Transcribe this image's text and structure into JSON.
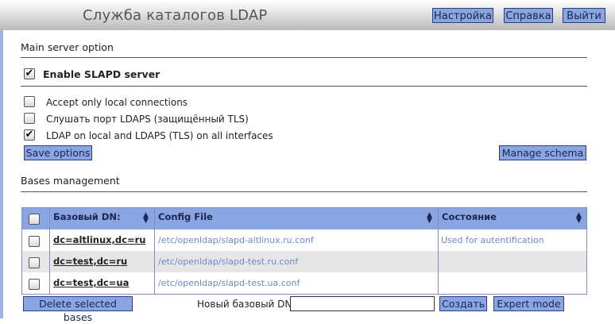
{
  "header": {
    "title": "Служба каталогов LDAP",
    "buttons": {
      "settings": "Настройка",
      "help": "Справка",
      "logout": "Выйти"
    }
  },
  "main_server": {
    "section_title": "Main server option",
    "enable_slapd": {
      "label": "Enable SLAPD server",
      "checked": true
    },
    "options": [
      {
        "label": "Accept only local connections",
        "checked": false
      },
      {
        "label": "Слушать порт LDAPS (защищённый TLS)",
        "checked": false
      },
      {
        "label": "LDAP on local and LDAPS (TLS) on all interfaces",
        "checked": true
      }
    ],
    "save_button": "Save options",
    "manage_schema_button": "Manage schema"
  },
  "bases": {
    "section_title": "Bases management",
    "columns": {
      "dn": "Базовый DN:",
      "config": "Config File",
      "state": "Состояние"
    },
    "rows": [
      {
        "dn": "dc=altlinux,dc=ru",
        "config": "/etc/openldap/slapd-altlinux.ru.conf",
        "state": "Used for autentification",
        "checked": false
      },
      {
        "dn": "dc=test,dc=ru",
        "config": "/etc/openldap/slapd-test.ru.conf",
        "state": "",
        "checked": false
      },
      {
        "dn": "dc=test,dc=ua",
        "config": "/etc/openldap/slapd-test.ua.conf",
        "state": "",
        "checked": false
      }
    ],
    "delete_button": "Delete selected bases",
    "new_dn_label": "Новый базовый DN:",
    "new_dn_value": "",
    "create_button": "Создать",
    "expert_button": "Expert mode"
  },
  "colors": {
    "button_bg": "#8aa6e2",
    "button_border": "#2c3e78",
    "link_text": "#6b88c8",
    "row_stripe": "#e6e6e6"
  }
}
